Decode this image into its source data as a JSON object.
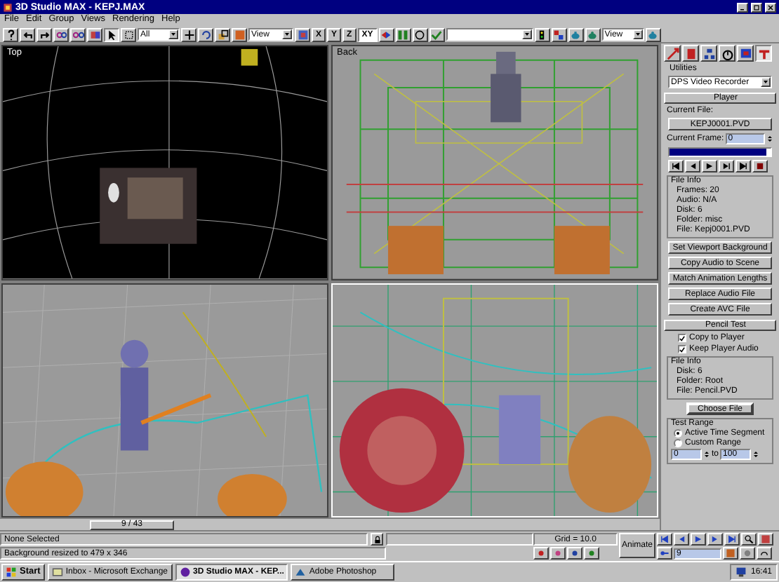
{
  "window": {
    "title": "3D Studio MAX - KEPJ.MAX"
  },
  "menu": [
    "File",
    "Edit",
    "Group",
    "Views",
    "Rendering",
    "Help"
  ],
  "toolbar": {
    "selection_filter": "All",
    "coordinate_systems": [
      "View",
      "View"
    ],
    "axis_buttons": [
      {
        "label": "X",
        "selected": false
      },
      {
        "label": "Y",
        "selected": false
      },
      {
        "label": "Z",
        "selected": false
      },
      {
        "label": "XY",
        "selected": true
      }
    ]
  },
  "viewports": [
    {
      "label": "Top",
      "kind": "dark",
      "active": false
    },
    {
      "label": "Back",
      "kind": "light",
      "active": false
    },
    {
      "kind": "light",
      "active": false
    },
    {
      "kind": "light",
      "active": true
    }
  ],
  "time_slider": {
    "label": "9 / 43"
  },
  "command_panel": {
    "tabs": [
      {
        "selected": false
      },
      {
        "selected": false
      },
      {
        "selected": false
      },
      {
        "selected": false
      },
      {
        "selected": false
      },
      {
        "selected": true
      }
    ],
    "section": "Utilities",
    "utility": "DPS Video Recorder",
    "player": {
      "title": "Player",
      "current_file_label": "Current File:",
      "current_file": "KEPJ0001.PVD",
      "current_frame_label": "Current Frame:",
      "current_frame": "0",
      "level": 0.96,
      "file_info_title": "File Info",
      "file_info": [
        "Frames: 20",
        "Audio: N/A",
        "Disk: 6",
        "Folder: misc",
        "File: Kepj0001.PVD"
      ],
      "buttons": [
        "Set Viewport Background",
        "Copy Audio to Scene",
        "Match Animation Lengths",
        "Replace Audio File",
        "Create AVC File"
      ]
    },
    "pencil_test": {
      "title": "Pencil Test",
      "options": [
        {
          "label": "Copy to Player",
          "checked": true
        },
        {
          "label": "Keep Player Audio",
          "checked": true
        }
      ],
      "file_info_title": "File Info",
      "file_info": [
        "Disk: 6",
        "Folder: Root",
        "File: Pencil.PVD"
      ],
      "choose_button": "Choose File",
      "range_title": "Test Range",
      "range_options": [
        {
          "label": "Active Time Segment",
          "selected": true
        },
        {
          "label": "Custom Range",
          "selected": false
        }
      ],
      "range_from": "0",
      "range_to_label": "to",
      "range_to": "100"
    }
  },
  "status": {
    "selection": "None Selected",
    "prompt": "Background resized to 479 x 346",
    "grid": "Grid = 10.0",
    "animate": "Animate",
    "frame": "9"
  },
  "taskbar": {
    "start": "Start",
    "tasks": [
      {
        "label": "Inbox - Microsoft Exchange",
        "selected": false
      },
      {
        "label": "3D Studio MAX - KEP...",
        "selected": true
      },
      {
        "label": "Adobe Photoshop",
        "selected": false
      }
    ],
    "clock": "16:41"
  }
}
